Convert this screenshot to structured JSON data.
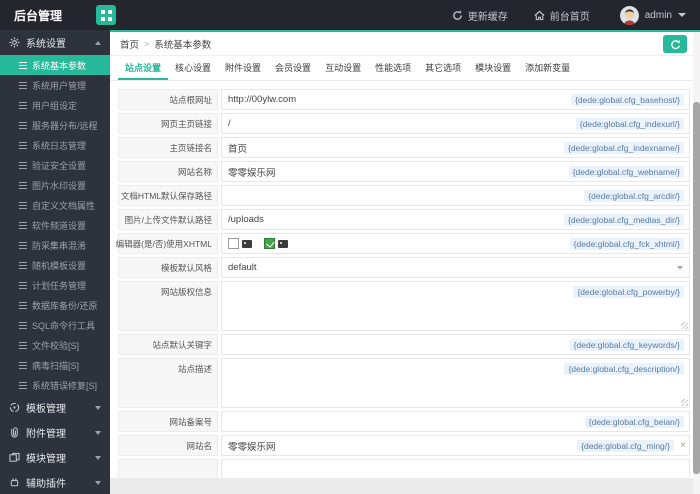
{
  "header": {
    "title": "后台管理",
    "cache_label": "更新缓存",
    "home_label": "前台首页",
    "username": "admin"
  },
  "breadcrumb": {
    "home": "首页",
    "separator": ">",
    "current": "系统基本参数"
  },
  "tabs": [
    "站点设置",
    "核心设置",
    "附件设置",
    "会员设置",
    "互动设置",
    "性能选项",
    "其它选项",
    "模块设置",
    "添加新变量"
  ],
  "sidebar": {
    "groups": [
      {
        "label": "系统设置",
        "expanded": true,
        "items": [
          "系统基本参数",
          "系统用户管理",
          "用户组设定",
          "服务器分布/远程",
          "系统日志管理",
          "验证安全设置",
          "图片水印设置",
          "自定义文档属性",
          "软件频道设置",
          "防采集串混淆",
          "随机模板设置",
          "计划任务管理",
          "数据库备份/还原",
          "SQL命令行工具",
          "文件校验[S]",
          "病毒扫描[S]",
          "系统错误修复[S]"
        ]
      },
      {
        "label": "模板管理",
        "expanded": false
      },
      {
        "label": "附件管理",
        "expanded": false
      },
      {
        "label": "模块管理",
        "expanded": false
      },
      {
        "label": "辅助插件",
        "expanded": false
      }
    ]
  },
  "form": {
    "rows": [
      {
        "label": "站点根网址",
        "value": "http://00ylw.com",
        "hint": "{dede:global.cfg_basehost/}"
      },
      {
        "label": "网页主页链接",
        "value": "/",
        "hint": "{dede:global.cfg_indexurl/}"
      },
      {
        "label": "主页链接名",
        "value": "首页",
        "hint": "{dede:global.cfg_indexname/}"
      },
      {
        "label": "网站名称",
        "value": "零零娱乐网",
        "hint": "{dede:global.cfg_webname/}"
      },
      {
        "label": "文档HTML默认保存路径",
        "value": "",
        "hint": "{dede:global.cfg_arcdir/}"
      },
      {
        "label": "图片/上传文件默认路径",
        "value": "/uploads",
        "hint": "{dede:global.cfg_medias_dir/}"
      },
      {
        "label": "编辑器(是/否)使用XHTML",
        "hint": "{dede:global.cfg_fck_xhtml/}"
      },
      {
        "label": "模板默认风格",
        "value": "default"
      },
      {
        "label": "网站版权信息",
        "value": "",
        "hint": "{dede:global.cfg_powerby/}"
      },
      {
        "label": "站点默认关键字",
        "value": "",
        "hint": "{dede:global.cfg_keywords/}"
      },
      {
        "label": "站点描述",
        "value": "",
        "hint": "{dede:global.cfg_description/}"
      },
      {
        "label": "网站备案号",
        "value": "",
        "hint": "{dede:global.cfg_beian/}"
      },
      {
        "label": "网站名",
        "value": "零零娱乐网",
        "hint": "{dede:global.cfg_ming/}"
      },
      {
        "label": ""
      }
    ]
  },
  "colors": {
    "accent": "#26b99a",
    "header_bg": "#23262d",
    "sidebar_bg": "#2e323c",
    "hint_text": "#577ca3",
    "hint_bg": "#eaf2fb"
  }
}
